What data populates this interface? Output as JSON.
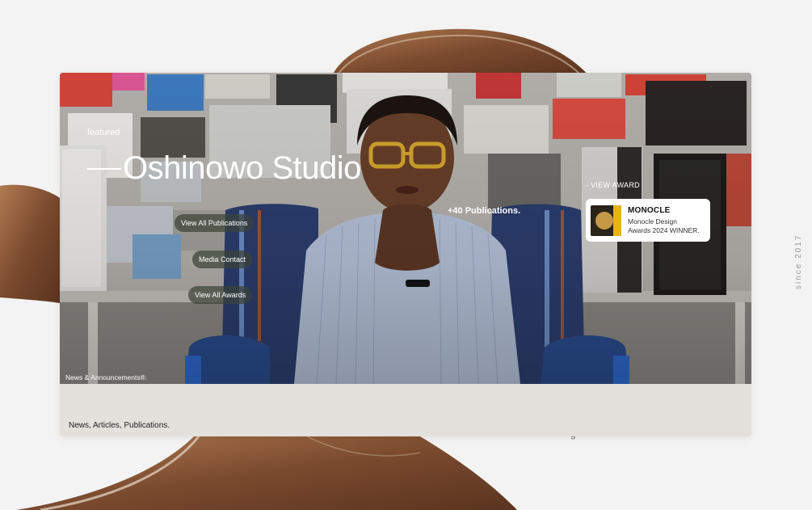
{
  "hero": {
    "featured_label": "featured",
    "title": "Oshinowo Studio",
    "publications_count": "+40 Publications.",
    "news_label": "News & Announcements®."
  },
  "actions": {
    "view_all_publications": "View All Publications",
    "media_contact": "Media Contact",
    "view_all_awards": "View All Awards"
  },
  "award": {
    "view_label": "- VIEW AWARD",
    "name": "MONOCLE",
    "description_line1": "Monocle Design",
    "description_line2": "Awards 2024 WINNER."
  },
  "footer": {
    "text": "News, Articles, Publications."
  },
  "side": {
    "since": "since 2017",
    "stray": "g"
  },
  "colors": {
    "page_bg": "#f3f3f3",
    "card_bg": "#e4e0dc",
    "pill_bg": "#3c4238",
    "wood": "#8a5a3b",
    "award_accent": "#e6b316"
  }
}
